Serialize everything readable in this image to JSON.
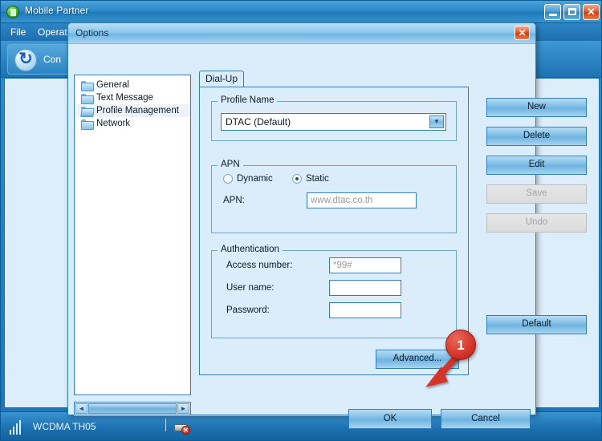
{
  "main_window": {
    "title": "Mobile Partner",
    "icon": "app-globe-icon",
    "menu": [
      {
        "label": "File"
      },
      {
        "label": "Operat"
      }
    ],
    "toolbar": {
      "connection_label": "Con",
      "connection_icon": "refresh-circle-icon"
    },
    "window_controls": {
      "minimize": "–",
      "maximize": "□",
      "close": "✕"
    },
    "statusbar": {
      "signal_icon": "signal-bars-icon",
      "network": "WCDMA TH05",
      "modem_icon": "modem-disconnected-icon",
      "modem_badge": "✕"
    }
  },
  "dialog": {
    "title": "Options",
    "close_label": "✕",
    "tree": {
      "items": [
        {
          "label": "General",
          "icon": "folder-icon",
          "selected": false
        },
        {
          "label": "Text Message",
          "icon": "folder-icon",
          "selected": false
        },
        {
          "label": "Profile Management",
          "icon": "folder-open-icon",
          "selected": true
        },
        {
          "label": "Network",
          "icon": "folder-icon",
          "selected": false
        }
      ],
      "scrollbar": {
        "left_arrow": "◄",
        "right_arrow": "►"
      }
    },
    "tabs": [
      {
        "label": "Dial-Up",
        "active": true
      }
    ],
    "profile_group": {
      "title": "Profile Name",
      "selected_value": "DTAC (Default)",
      "dropdown_arrow": "▼"
    },
    "apn_group": {
      "title": "APN",
      "radios": [
        {
          "label": "Dynamic",
          "selected": false
        },
        {
          "label": "Static",
          "selected": true
        }
      ],
      "apn_label": "APN:",
      "apn_value": "www.dtac.co.th"
    },
    "auth_group": {
      "title": "Authentication",
      "fields": [
        {
          "label": "Access number:",
          "value": "*99#",
          "is_placeholder": true
        },
        {
          "label": "User name:",
          "value": "",
          "is_placeholder": false
        },
        {
          "label": "Password:",
          "value": "",
          "is_placeholder": false
        }
      ]
    },
    "advanced_button": "Advanced...",
    "side_buttons": [
      {
        "label": "New",
        "disabled": false
      },
      {
        "label": "Delete",
        "disabled": false
      },
      {
        "label": "Edit",
        "disabled": false
      },
      {
        "label": "Save",
        "disabled": true
      },
      {
        "label": "Undo",
        "disabled": true
      }
    ],
    "default_button": "Default",
    "footer": {
      "ok": "OK",
      "cancel": "Cancel"
    }
  },
  "annotation": {
    "badge_number": "1",
    "points_to": "ok-button"
  },
  "colors": {
    "title_blue": "#2b86c6",
    "dialog_bg": "#dbecfa",
    "button_blue": "#7dbde6",
    "accent_red": "#d4352a",
    "border_blue": "#2f7fbd"
  }
}
